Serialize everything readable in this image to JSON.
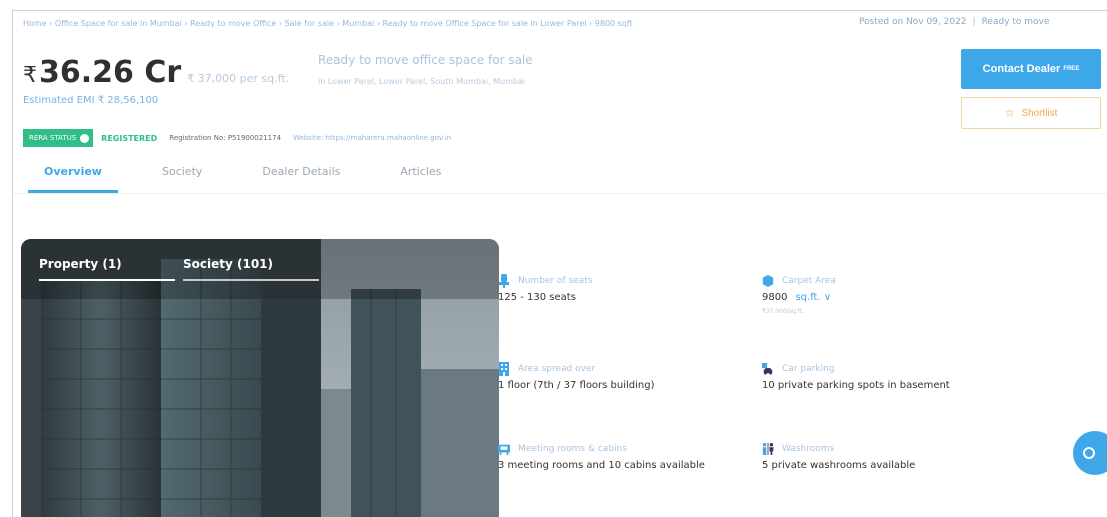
{
  "breadcrumb": "Home › Office Space for sale in Mumbai › Ready to move Office › Sale for sale › Mumbai › Ready to move Office Space for sale in Lower Parel › 9800 sqft",
  "header": {
    "posted": "Posted on Nov 09, 2022",
    "status": "Ready to move"
  },
  "price": {
    "currency": "₹",
    "amount": "36.26 Cr",
    "per_sqft": "₹ 37,000 per sq.ft.",
    "emi": "Estimated EMI ₹ 28,56,100"
  },
  "listing": {
    "headline": "Ready to move office space for sale",
    "location": "in Lower Parel, Lower Parel, South Mumbai, Mumbai"
  },
  "actions": {
    "contact": "Contact Dealer",
    "contact_badge": "FREE",
    "shortlist": "Shortlist"
  },
  "rera": {
    "badge": "RERA STATUS",
    "status": "REGISTERED",
    "registration": "Registration No: P51900021174",
    "website": "Website: https://maharera.mahaonline.gov.in"
  },
  "tabs": [
    "Overview",
    "Society",
    "Dealer Details",
    "Articles"
  ],
  "gallery": {
    "tab_property": "Property (1)",
    "tab_society": "Society (101)"
  },
  "details": {
    "seats_label": "Number of seats",
    "seats_value": "125 - 130 seats",
    "carpet_label": "Carpet Area",
    "carpet_value": "9800",
    "carpet_unit": "sq.ft. ∨",
    "carpet_note": "₹37,000/sq.ft.",
    "area_label": "Area spread over",
    "area_value": "1 floor (7th / 37 floors building)",
    "parking_label": "Car parking",
    "parking_value": "10 private parking spots in basement",
    "meeting_label": "Meeting rooms & cabins",
    "meeting_value": "3 meeting rooms and 10 cabins available",
    "washroom_label": "Washrooms",
    "washroom_value": "5 private washrooms available"
  },
  "colors": {
    "accent": "#3ea7e8",
    "rera_green": "#2fbf86",
    "shortlist_orange": "#f0a94a"
  }
}
